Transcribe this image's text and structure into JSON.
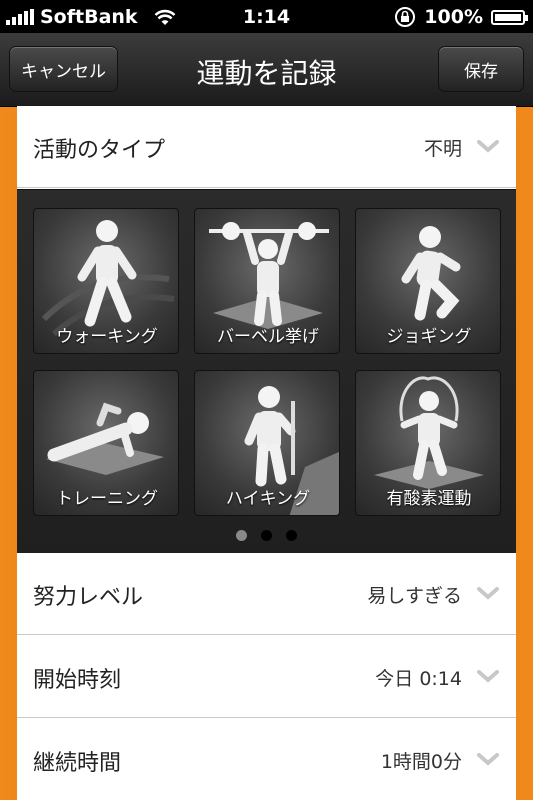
{
  "status_bar": {
    "carrier": "SoftBank",
    "time": "1:14",
    "battery": "100%",
    "icons": [
      "signal-icon",
      "wifi-icon",
      "rotation-lock-icon",
      "battery-icon"
    ]
  },
  "nav": {
    "cancel_label": "キャンセル",
    "title": "運動を記録",
    "save_label": "保存"
  },
  "form": {
    "activity_type": {
      "label": "活動のタイプ",
      "value": "不明"
    },
    "effort_level": {
      "label": "努力レベル",
      "value": "易しすぎる"
    },
    "start_time": {
      "label": "開始時刻",
      "value": "今日 0:14"
    },
    "duration": {
      "label": "継続時間",
      "value": "1時間0分"
    }
  },
  "activities": [
    {
      "label": "ウォーキング",
      "icon": "walking-figure-icon"
    },
    {
      "label": "バーベル挙げ",
      "icon": "barbell-lift-figure-icon"
    },
    {
      "label": "ジョギング",
      "icon": "jogging-figure-icon"
    },
    {
      "label": "トレーニング",
      "icon": "pushup-figure-icon"
    },
    {
      "label": "ハイキング",
      "icon": "hiking-figure-icon"
    },
    {
      "label": "有酸素運動",
      "icon": "jump-rope-figure-icon"
    }
  ],
  "pager": {
    "pages": 3,
    "current": 1
  },
  "colors": {
    "accent": "#e35a14",
    "nav": "#1b1b1b",
    "panel": "#262626"
  }
}
